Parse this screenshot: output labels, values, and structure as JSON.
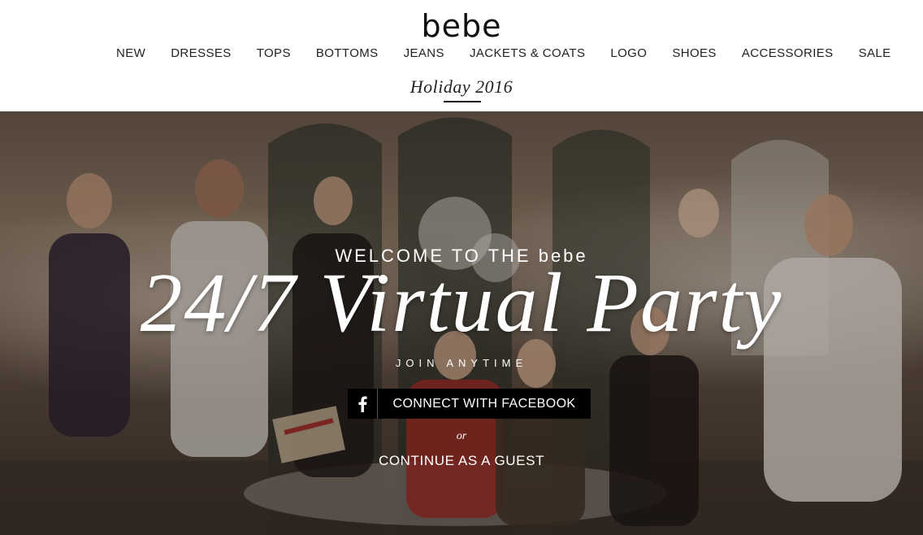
{
  "brand": {
    "logo_text": "bebe"
  },
  "nav": {
    "items": [
      {
        "label": "NEW"
      },
      {
        "label": "DRESSES"
      },
      {
        "label": "TOPS"
      },
      {
        "label": "BOTTOMS"
      },
      {
        "label": "JEANS"
      },
      {
        "label": "JACKETS & COATS"
      },
      {
        "label": "LOGO"
      },
      {
        "label": "SHOES"
      },
      {
        "label": "ACCESSORIES"
      },
      {
        "label": "SALE"
      }
    ]
  },
  "page": {
    "season_title": "Holiday 2016"
  },
  "hero": {
    "welcome_text": "WELCOME TO THE bebe",
    "headline": "24/7 Virtual Party",
    "subhead": "JOIN ANYTIME",
    "facebook_button_label": "CONNECT WITH FACEBOOK",
    "or_text": "or",
    "guest_link_label": "CONTINUE AS A GUEST"
  },
  "colors": {
    "text_dark": "#222222",
    "button_bg": "#000000",
    "overlay_text": "#ffffff"
  },
  "icons": {
    "facebook": "facebook-icon"
  }
}
